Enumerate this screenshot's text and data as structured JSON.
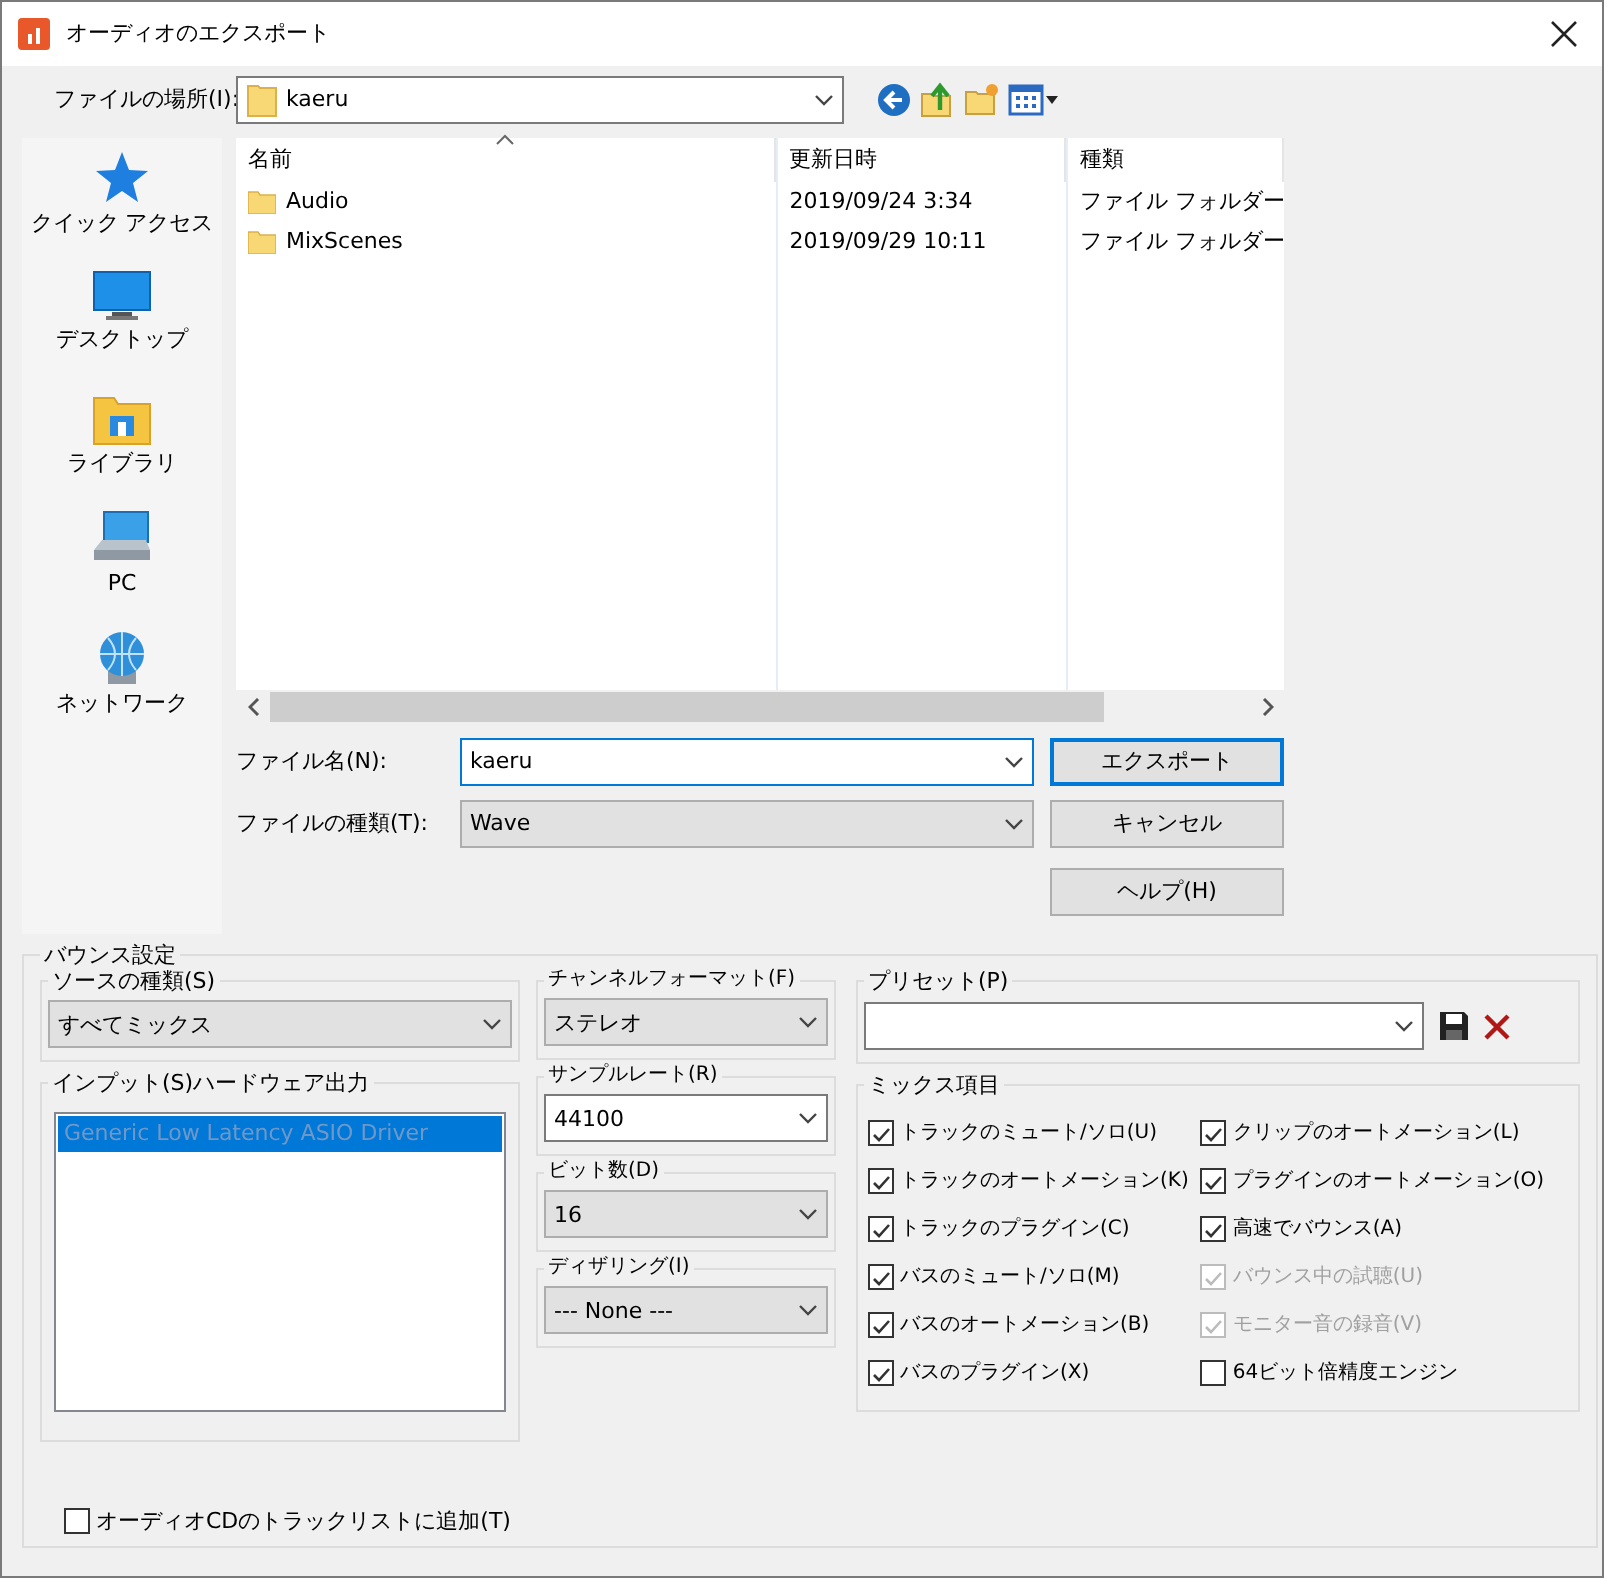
{
  "window": {
    "title": "オーディオのエクスポート"
  },
  "location": {
    "label": "ファイルの場所(I):",
    "value": "kaeru"
  },
  "places": [
    {
      "label": "クイック アクセス",
      "kind": "star"
    },
    {
      "label": "デスクトップ",
      "kind": "desktop"
    },
    {
      "label": "ライブラリ",
      "kind": "library"
    },
    {
      "label": "PC",
      "kind": "pc"
    },
    {
      "label": "ネットワーク",
      "kind": "network"
    }
  ],
  "file_list": {
    "columns": [
      "名前",
      "更新日時",
      "種類"
    ],
    "rows": [
      {
        "name": "Audio",
        "modified": "2019/09/24 3:34",
        "type": "ファイル フォルダー"
      },
      {
        "name": "MixScenes",
        "modified": "2019/09/29 10:11",
        "type": "ファイル フォルダー"
      }
    ]
  },
  "file_name": {
    "label": "ファイル名(N):",
    "value": "kaeru",
    "kind": "edit"
  },
  "file_type": {
    "label": "ファイルの種類(T):",
    "value": "Wave",
    "kind": "list"
  },
  "buttons": [
    {
      "label": "エクスポート",
      "default": true
    },
    {
      "label": "キャンセル",
      "default": false
    },
    {
      "label": "ヘルプ(H)",
      "default": false
    }
  ],
  "bounce": {
    "title": "バウンス設定",
    "source_type": {
      "label": "ソースの種類(S)",
      "value": "すべてミックス",
      "kind": "list"
    },
    "input": {
      "label": "インプット(S)ハードウェア出力",
      "items": [
        {
          "label": "Generic Low Latency ASIO Driver",
          "selected": true
        }
      ]
    },
    "channel_format": {
      "label": "チャンネルフォーマット(F)",
      "value": "ステレオ",
      "kind": "list"
    },
    "sample_rate": {
      "label": "サンプルレート(R)",
      "value": "44100",
      "kind": "edit"
    },
    "bit_depth": {
      "label": "ビット数(D)",
      "value": "16",
      "kind": "list"
    },
    "dithering": {
      "label": "ディザリング(I)",
      "value": "--- None ---",
      "kind": "list"
    },
    "preset": {
      "label": "プリセット(P)"
    },
    "mix_items": {
      "label": "ミックス項目",
      "items": [
        {
          "label": "トラックのミュート/ソロ(U)",
          "checked": true,
          "disabled": false
        },
        {
          "label": "トラックのオートメーション(K)",
          "checked": true,
          "disabled": false
        },
        {
          "label": "トラックのプラグイン(C)",
          "checked": true,
          "disabled": false
        },
        {
          "label": "バスのミュート/ソロ(M)",
          "checked": true,
          "disabled": false
        },
        {
          "label": "バスのオートメーション(B)",
          "checked": true,
          "disabled": false
        },
        {
          "label": "バスのプラグイン(X)",
          "checked": true,
          "disabled": false
        },
        {
          "label": "クリップのオートメーション(L)",
          "checked": true,
          "disabled": false
        },
        {
          "label": "プラグインのオートメーション(O)",
          "checked": true,
          "disabled": false
        },
        {
          "label": "高速でバウンス(A)",
          "checked": true,
          "disabled": false
        },
        {
          "label": "バウンス中の試聴(U)",
          "checked": true,
          "disabled": true
        },
        {
          "label": "モニター音の録音(V)",
          "checked": true,
          "disabled": true
        },
        {
          "label": "64ビット倍精度エンジン",
          "checked": false,
          "disabled": false
        }
      ]
    },
    "add_to_cd": {
      "label": "オーディオCDのトラックリストに追加(T)",
      "checked": false
    }
  }
}
